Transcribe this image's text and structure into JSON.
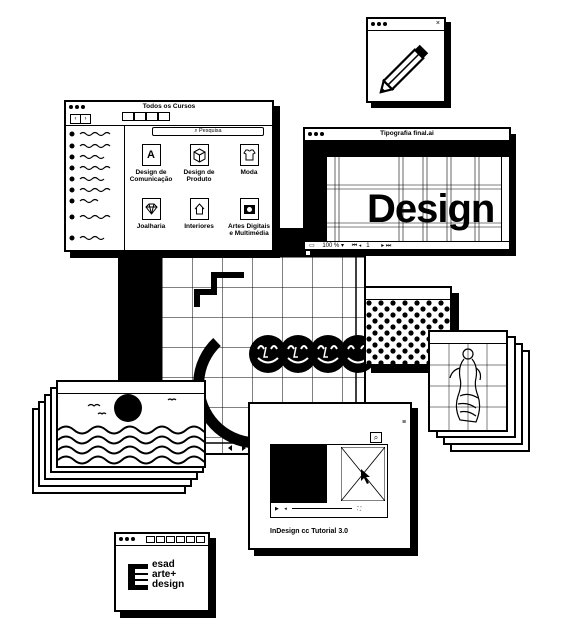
{
  "courses_window": {
    "title": "Todos os Cursos",
    "search_placeholder": "Pesquisa",
    "courses": [
      {
        "label": "Design de Comunicação",
        "icon": "letter-a-icon"
      },
      {
        "label": "Design de Produto",
        "icon": "box-icon"
      },
      {
        "label": "Moda",
        "icon": "tshirt-icon"
      },
      {
        "label": "Joalharia",
        "icon": "diamond-icon"
      },
      {
        "label": "Interiores",
        "icon": "house-icon"
      },
      {
        "label": "Artes Digitais e Multimédia",
        "icon": "camera-icon"
      }
    ]
  },
  "typography_window": {
    "title": "Tipografia final.ai",
    "canvas_text": "Design",
    "zoom": "100 %",
    "page": "1"
  },
  "tutorial_window": {
    "caption": "InDesign cc Tutorial 3.0"
  },
  "logo_window": {
    "logo_lines": [
      "esad",
      "arte+",
      "design"
    ]
  }
}
